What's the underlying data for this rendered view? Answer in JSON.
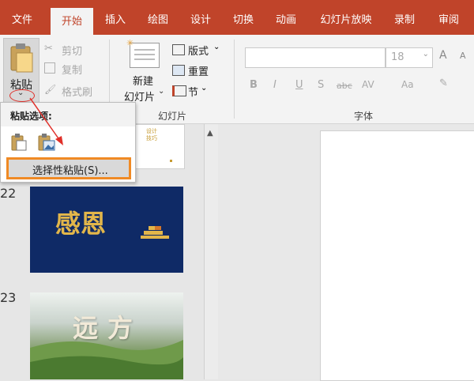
{
  "menubar": {
    "tabs": [
      {
        "label": "文件"
      },
      {
        "label": "开始"
      },
      {
        "label": "插入"
      },
      {
        "label": "绘图"
      },
      {
        "label": "设计"
      },
      {
        "label": "切换"
      },
      {
        "label": "动画"
      },
      {
        "label": "幻灯片放映"
      },
      {
        "label": "录制"
      },
      {
        "label": "审阅"
      }
    ]
  },
  "clipboard": {
    "paste_label": "粘贴",
    "cut_label": "剪切",
    "copy_label": "复制",
    "format_painter_label": "格式刷"
  },
  "slides_group": {
    "new_slide_label_1": "新建",
    "new_slide_label_2": "幻灯片",
    "layout_label": "版式",
    "reset_label": "重置",
    "section_label": "节",
    "group_label": "幻灯片"
  },
  "font_group": {
    "font_size": "18",
    "group_label": "字体",
    "bold": "B",
    "italic": "I",
    "underline": "U",
    "strike": "S",
    "abc": "abc",
    "av": "AV",
    "aa": "Aa",
    "grow": "A",
    "shrink": "A"
  },
  "paste_menu": {
    "title": "粘贴选项:",
    "special_label": "选择性粘贴(S)..."
  },
  "thumbnails": [
    {
      "number": "",
      "mini_text": "设计\n技巧"
    },
    {
      "number": "22",
      "title": "感恩"
    },
    {
      "number": "23",
      "title": "远方"
    }
  ],
  "colors": {
    "accent": "#c0442a",
    "highlight": "#f08a24",
    "arrow": "#e0302a",
    "slide22_bg": "#0f2a66",
    "slide22_text": "#e2b64a"
  }
}
